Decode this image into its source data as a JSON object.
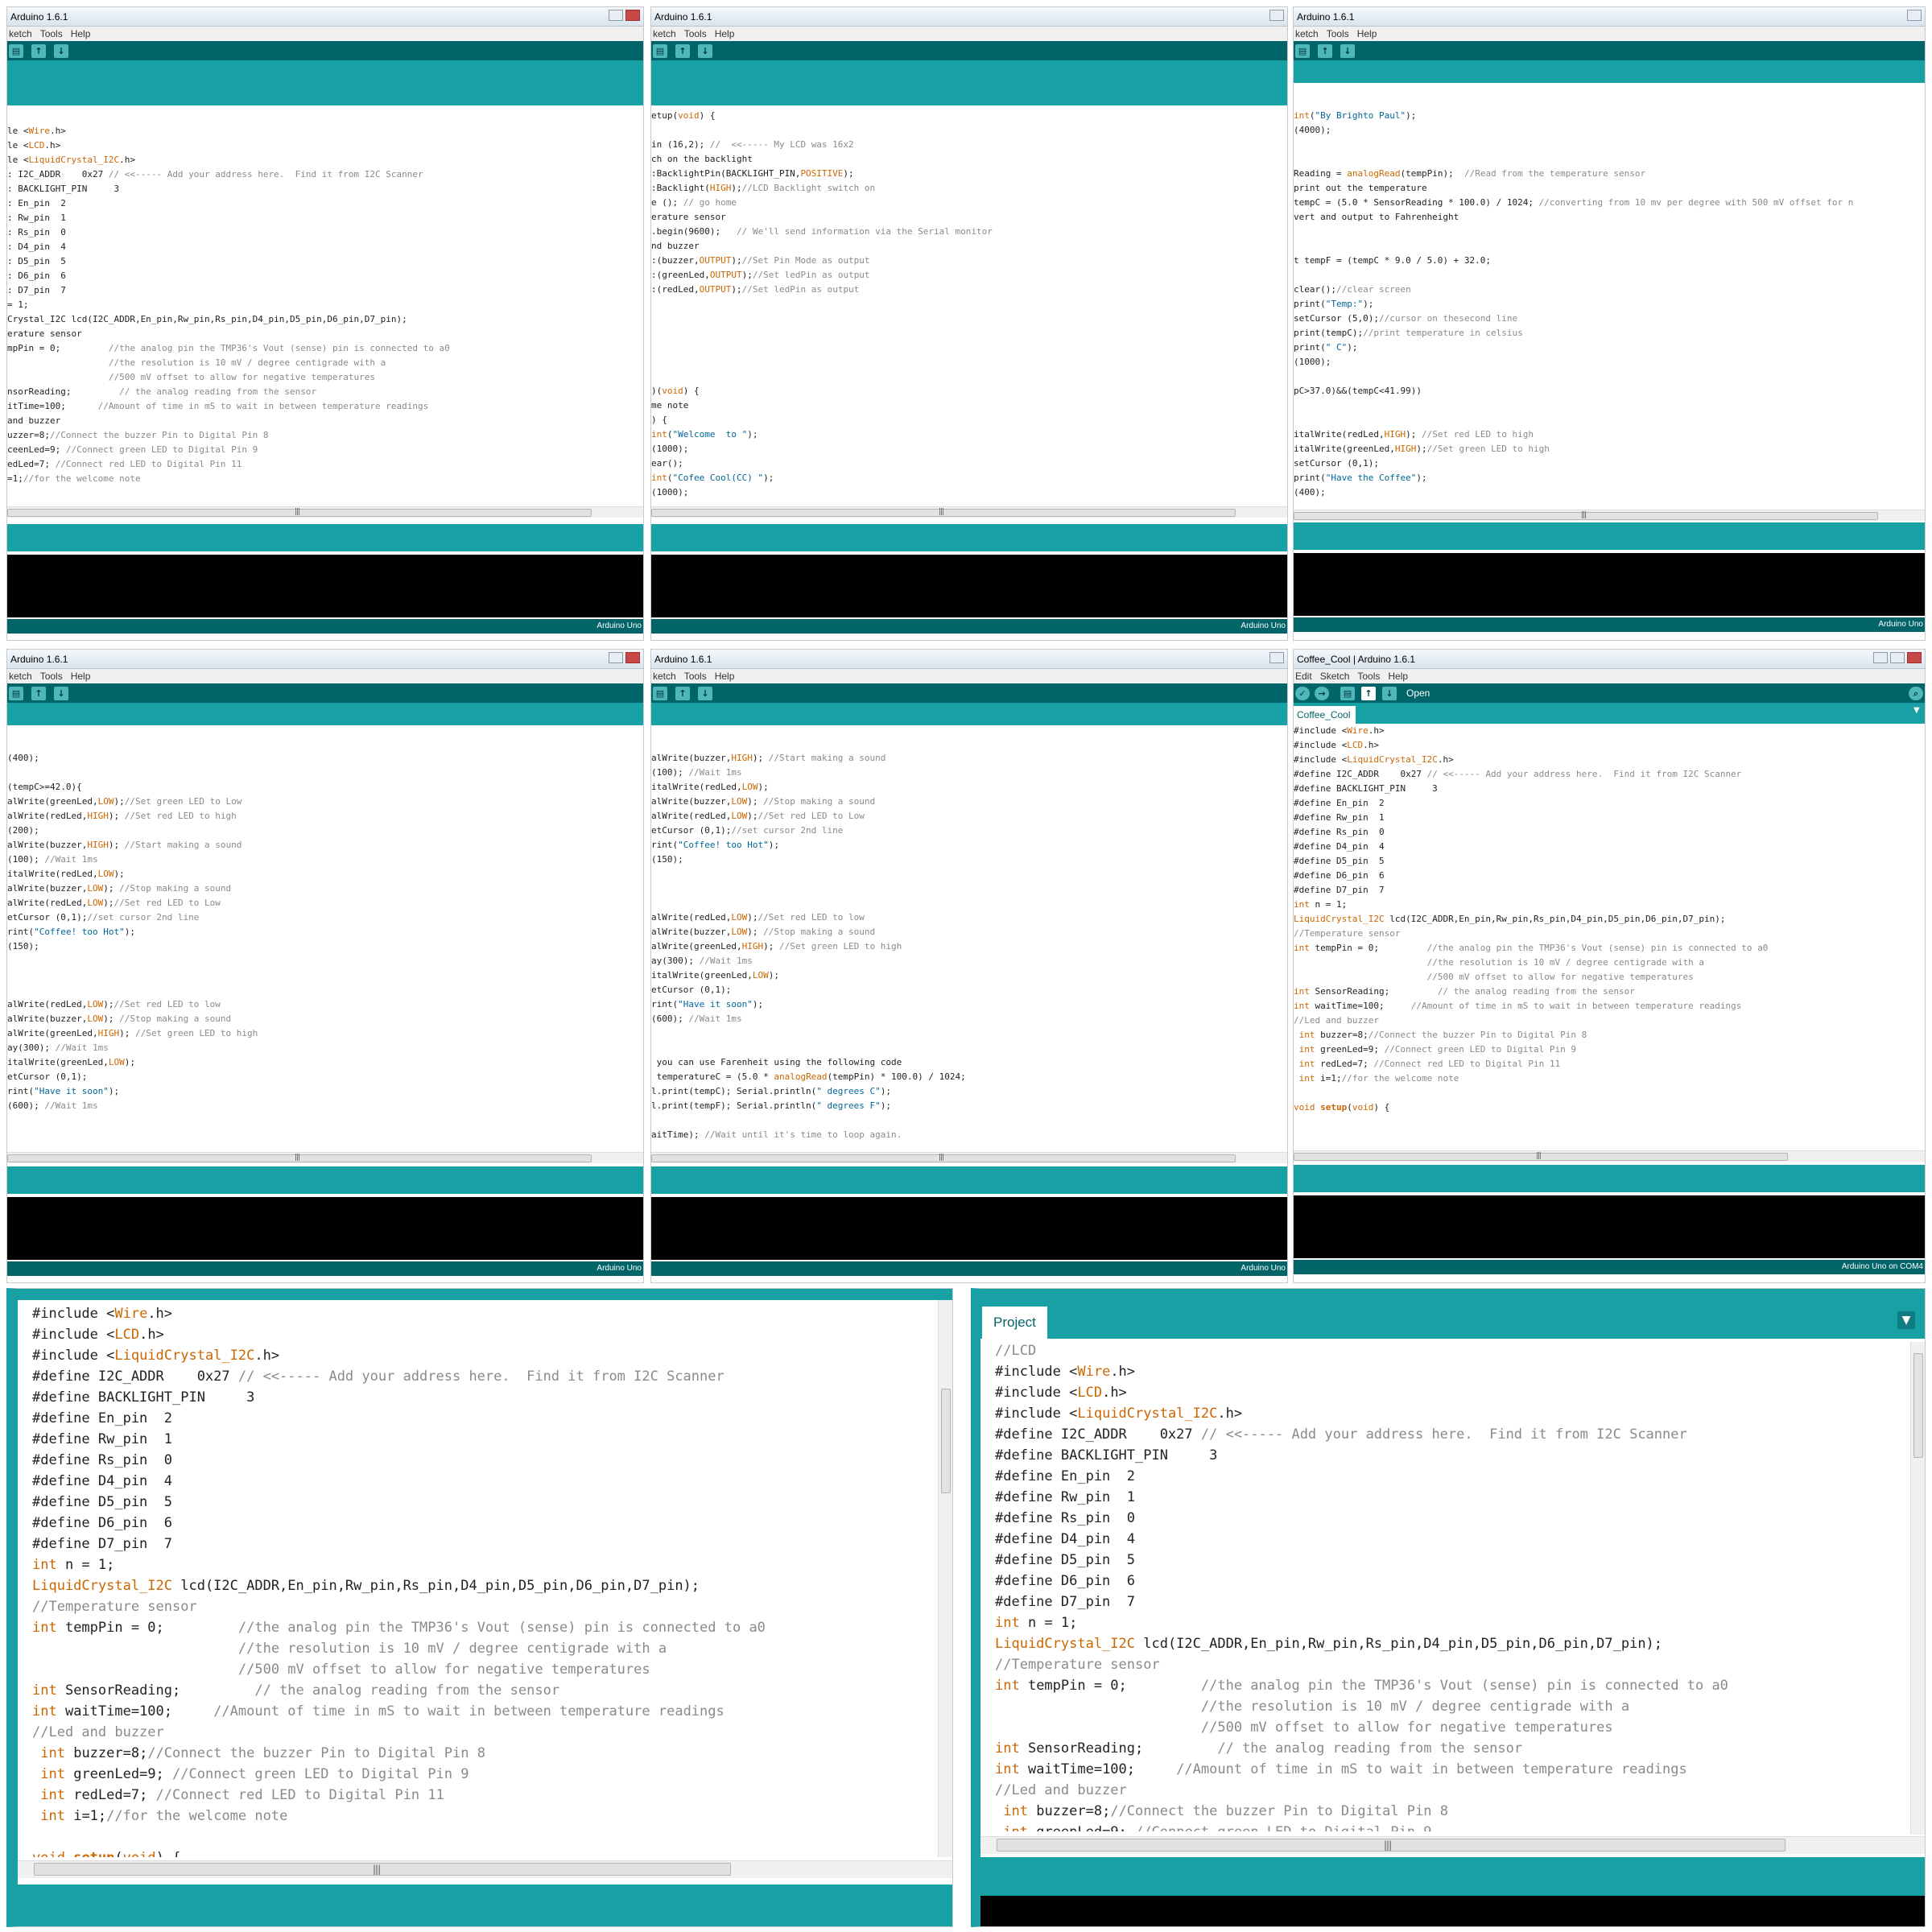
{
  "app_title": "Arduino 1.6.1",
  "app_title_full": "Coffee_Cool | Arduino 1.6.1",
  "menus_cut": [
    "ketch",
    "Tools",
    "Help"
  ],
  "menus_full": [
    "Edit",
    "Sketch",
    "Tools",
    "Help"
  ],
  "toolbar_open_label": "Open",
  "sketch_tab": "Coffee_Cool",
  "project_tab": "Project",
  "board_status": "Arduino Uno",
  "board_status_port": "Arduino Uno on COM4",
  "scroll_grip": "|||",
  "colors": {
    "toolbar": "#006468",
    "tabbar": "#17a1a5",
    "keyword": "#cc6600",
    "string": "#006699",
    "comment": "#8a8a8a"
  },
  "icons": [
    "new-icon",
    "open-icon",
    "save-icon",
    "verify-icon",
    "upload-icon",
    "serial-monitor-icon",
    "minimize-icon",
    "maximize-icon",
    "close-icon",
    "tab-menu-icon"
  ],
  "panel1_code": "le <Wire.h>\nle <LCD.h>\nle <LiquidCrystal_I2C.h>\n: I2C_ADDR    0x27 // <<----- Add your address here.  Find it from I2C Scanner\n: BACKLIGHT_PIN     3\n: En_pin  2\n: Rw_pin  1\n: Rs_pin  0\n: D4_pin  4\n: D5_pin  5\n: D6_pin  6\n: D7_pin  7\n= 1;\nCrystal_I2C lcd(I2C_ADDR,En_pin,Rw_pin,Rs_pin,D4_pin,D5_pin,D6_pin,D7_pin);\nerature sensor\nmpPin = 0;         //the analog pin the TMP36's Vout (sense) pin is connected to a0\n                   //the resolution is 10 mV / degree centigrade with a\n                   //500 mV offset to allow for negative temperatures\nnsorReading;         // the analog reading from the sensor\nitTime=100;      //Amount of time in mS to wait in between temperature readings\nand buzzer\nuzzer=8;//Connect the buzzer Pin to Digital Pin 8\nceenLed=9; //Connect green LED to Digital Pin 9\nedLed=7; //Connect red LED to Digital Pin 11\n=1;//for the welcome note",
  "panel2_code": "etup(void) {\n\nin (16,2); //  <<----- My LCD was 16x2\nch on the backlight\n:BacklightPin(BACKLIGHT_PIN,POSITIVE);\n:Backlight(HIGH);//LCD Backlight switch on\ne (); // go home\nerature sensor\n.begin(9600);   // We'll send information via the Serial monitor\nnd buzzer\n:(buzzer,OUTPUT);//Set Pin Mode as output\n:(greenLed,OUTPUT);//Set ledPin as output\n:(redLed,OUTPUT);//Set ledPin as output\n\n\n\n\n\n\n)(void) {\nme note\n) {\nint(\"Welcome  to \");\n(1000);\near();\nint(\"Cofee Cool(CC) \");\n(1000);\netCursor (0,1);",
  "panel3_code": "int(\"By Brighto Paul\");\n(4000);\n\n\nReading = analogRead(tempPin);  //Read from the temperature sensor\nprint out the temperature\ntempC = (5.0 * SensorReading * 100.0) / 1024; //converting from 10 mv per degree with 500 mV offset for n\nvert and output to Fahrenheight\n\n\nt tempF = (tempC * 9.0 / 5.0) + 32.0;\n\nclear();//clear screen\nprint(\"Temp:\");\nsetCursor (5,0);//cursor on thesecond line\nprint(tempC);//print temperature in celsius\nprint(\" C\");\n(1000);\n\npC>37.0)&&(tempC<41.99))\n\n\nitalWrite(redLed,HIGH); //Set red LED to high\nitalWrite(greenLed,HIGH);//Set green LED to high\nsetCursor (0,1);\nprint(\"Have the Coffee\");\n(400);",
  "panel4_code": "(400);\n\n(tempC>=42.0){\nalWrite(greenLed,LOW);//Set green LED to Low\nalWrite(redLed,HIGH); //Set red LED to high\n(200);\nalWrite(buzzer,HIGH); //Start making a sound\n(100); //Wait 1ms\nitalWrite(redLed,LOW);\nalWrite(buzzer,LOW); //Stop making a sound\nalWrite(redLed,LOW);//Set red LED to Low\netCursor (0,1);//set cursor 2nd line\nrint(\"Coffee! too Hot\");\n(150);\n\n\n\nalWrite(redLed,LOW);//Set red LED to low\nalWrite(buzzer,LOW); //Stop making a sound\nalWrite(greenLed,HIGH); //Set green LED to high\nay(300); //Wait 1ms\nitalWrite(greenLed,LOW);\netCursor (0,1);\nrint(\"Have it soon\");\n(600); //Wait 1ms\n\n\n\n you can use Farenheit using the following code",
  "panel5_code": "alWrite(buzzer,HIGH); //Start making a sound\n(100); //Wait 1ms\nitalWrite(redLed,LOW);\nalWrite(buzzer,LOW); //Stop making a sound\nalWrite(redLed,LOW);//Set red LED to Low\netCursor (0,1);//set cursor 2nd line\nrint(\"Coffee! too Hot\");\n(150);\n\n\n\nalWrite(redLed,LOW);//Set red LED to low\nalWrite(buzzer,LOW); //Stop making a sound\nalWrite(greenLed,HIGH); //Set green LED to high\nay(300); //Wait 1ms\nitalWrite(greenLed,LOW);\netCursor (0,1);\nrint(\"Have it soon\");\n(600); //Wait 1ms\n\n\n you can use Farenheit using the following code\n temperatureC = (5.0 * analogRead(tempPin) * 100.0) / 1024;\nl.print(tempC); Serial.println(\" degrees C\");\nl.print(tempF); Serial.println(\" degrees F\");\n\naitTime); //Wait until it's time to loop again.",
  "panel6_code": "#include <Wire.h>\n#include <LCD.h>\n#include <LiquidCrystal_I2C.h>\n#define I2C_ADDR    0x27 // <<----- Add your address here.  Find it from I2C Scanner\n#define BACKLIGHT_PIN     3\n#define En_pin  2\n#define Rw_pin  1\n#define Rs_pin  0\n#define D4_pin  4\n#define D5_pin  5\n#define D6_pin  6\n#define D7_pin  7\nint n = 1;\nLiquidCrystal_I2C lcd(I2C_ADDR,En_pin,Rw_pin,Rs_pin,D4_pin,D5_pin,D6_pin,D7_pin);\n//Temperature sensor\nint tempPin = 0;         //the analog pin the TMP36's Vout (sense) pin is connected to a0\n                         //the resolution is 10 mV / degree centigrade with a\n                         //500 mV offset to allow for negative temperatures\nint SensorReading;         // the analog reading from the sensor\nint waitTime=100;     //Amount of time in mS to wait in between temperature readings\n//Led and buzzer\n int buzzer=8;//Connect the buzzer Pin to Digital Pin 8\n int greenLed=9; //Connect green LED to Digital Pin 9\n int redLed=7; //Connect red LED to Digital Pin 11\n int i=1;//for the welcome note\n\nvoid setup(void) {",
  "panel7_code": "#include <Wire.h>\n#include <LCD.h>\n#include <LiquidCrystal_I2C.h>\n#define I2C_ADDR    0x27 // <<----- Add your address here.  Find it from I2C Scanner\n#define BACKLIGHT_PIN     3\n#define En_pin  2\n#define Rw_pin  1\n#define Rs_pin  0\n#define D4_pin  4\n#define D5_pin  5\n#define D6_pin  6\n#define D7_pin  7\nint n = 1;\nLiquidCrystal_I2C lcd(I2C_ADDR,En_pin,Rw_pin,Rs_pin,D4_pin,D5_pin,D6_pin,D7_pin);\n//Temperature sensor\nint tempPin = 0;         //the analog pin the TMP36's Vout (sense) pin is connected to a0\n                         //the resolution is 10 mV / degree centigrade with a\n                         //500 mV offset to allow for negative temperatures\nint SensorReading;         // the analog reading from the sensor\nint waitTime=100;     //Amount of time in mS to wait in between temperature readings\n//Led and buzzer\n int buzzer=8;//Connect the buzzer Pin to Digital Pin 8\n int greenLed=9; //Connect green LED to Digital Pin 9\n int redLed=7; //Connect red LED to Digital Pin 11\n int i=1;//for the welcome note\n\nvoid setup(void) {",
  "panel8_code": "//LCD\n#include <Wire.h>\n#include <LCD.h>\n#include <LiquidCrystal_I2C.h>\n#define I2C_ADDR    0x27 // <<----- Add your address here.  Find it from I2C Scanner\n#define BACKLIGHT_PIN     3\n#define En_pin  2\n#define Rw_pin  1\n#define Rs_pin  0\n#define D4_pin  4\n#define D5_pin  5\n#define D6_pin  6\n#define D7_pin  7\nint n = 1;\nLiquidCrystal_I2C lcd(I2C_ADDR,En_pin,Rw_pin,Rs_pin,D4_pin,D5_pin,D6_pin,D7_pin);\n//Temperature sensor\nint tempPin = 0;         //the analog pin the TMP36's Vout (sense) pin is connected to a0\n                         //the resolution is 10 mV / degree centigrade with a\n                         //500 mV offset to allow for negative temperatures\nint SensorReading;         // the analog reading from the sensor\nint waitTime=100;     //Amount of time in mS to wait in between temperature readings\n//Led and buzzer\n int buzzer=8;//Connect the buzzer Pin to Digital Pin 8\n int greenLed=9; //Connect green LED to Digital Pin 9\n int redLed=7; //Connect red LED to Digital Pin 11\n int i=1;//for the welcome note"
}
